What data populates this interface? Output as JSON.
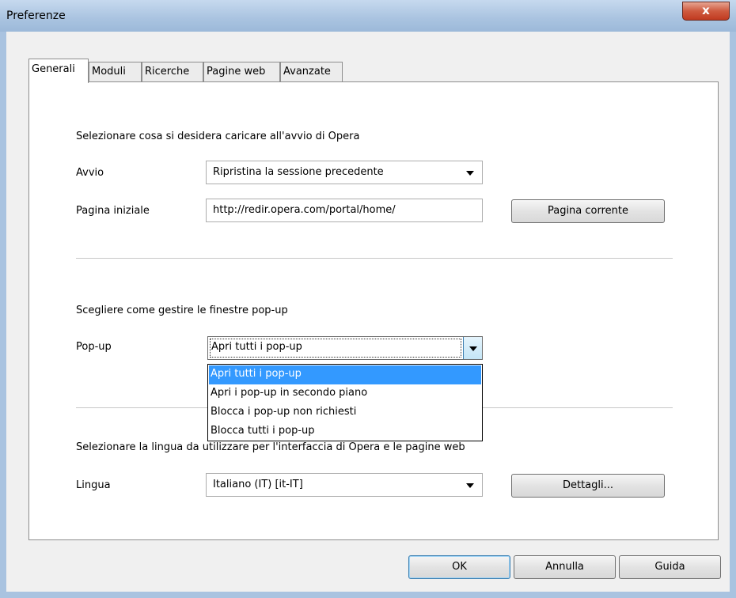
{
  "window": {
    "title": "Preferenze",
    "close_label": "x"
  },
  "tabs": [
    {
      "label": "Generali",
      "active": true
    },
    {
      "label": "Moduli",
      "active": false
    },
    {
      "label": "Ricerche",
      "active": false
    },
    {
      "label": "Pagine web",
      "active": false
    },
    {
      "label": "Avanzate",
      "active": false
    }
  ],
  "startup": {
    "heading": "Selezionare cosa si desidera caricare all'avvio di Opera",
    "avvio_label": "Avvio",
    "avvio_value": "Ripristina la sessione precedente",
    "homepage_label": "Pagina iniziale",
    "homepage_value": "http://redir.opera.com/portal/home/",
    "current_page_button": "Pagina corrente"
  },
  "popups": {
    "heading": "Scegliere come gestire le finestre pop-up",
    "label": "Pop-up",
    "value": "Apri tutti i pop-up",
    "options": [
      "Apri tutti i pop-up",
      "Apri i pop-up in secondo piano",
      "Blocca i pop-up non richiesti",
      "Blocca tutti i pop-up"
    ],
    "selected_index": 0
  },
  "language": {
    "heading": "Selezionare la lingua da utilizzare per l'interfaccia di Opera e le pagine web",
    "label": "Lingua",
    "value": "Italiano (IT) [it-IT]",
    "details_button": "Dettagli..."
  },
  "footer": {
    "ok": "OK",
    "cancel": "Annulla",
    "help": "Guida"
  }
}
